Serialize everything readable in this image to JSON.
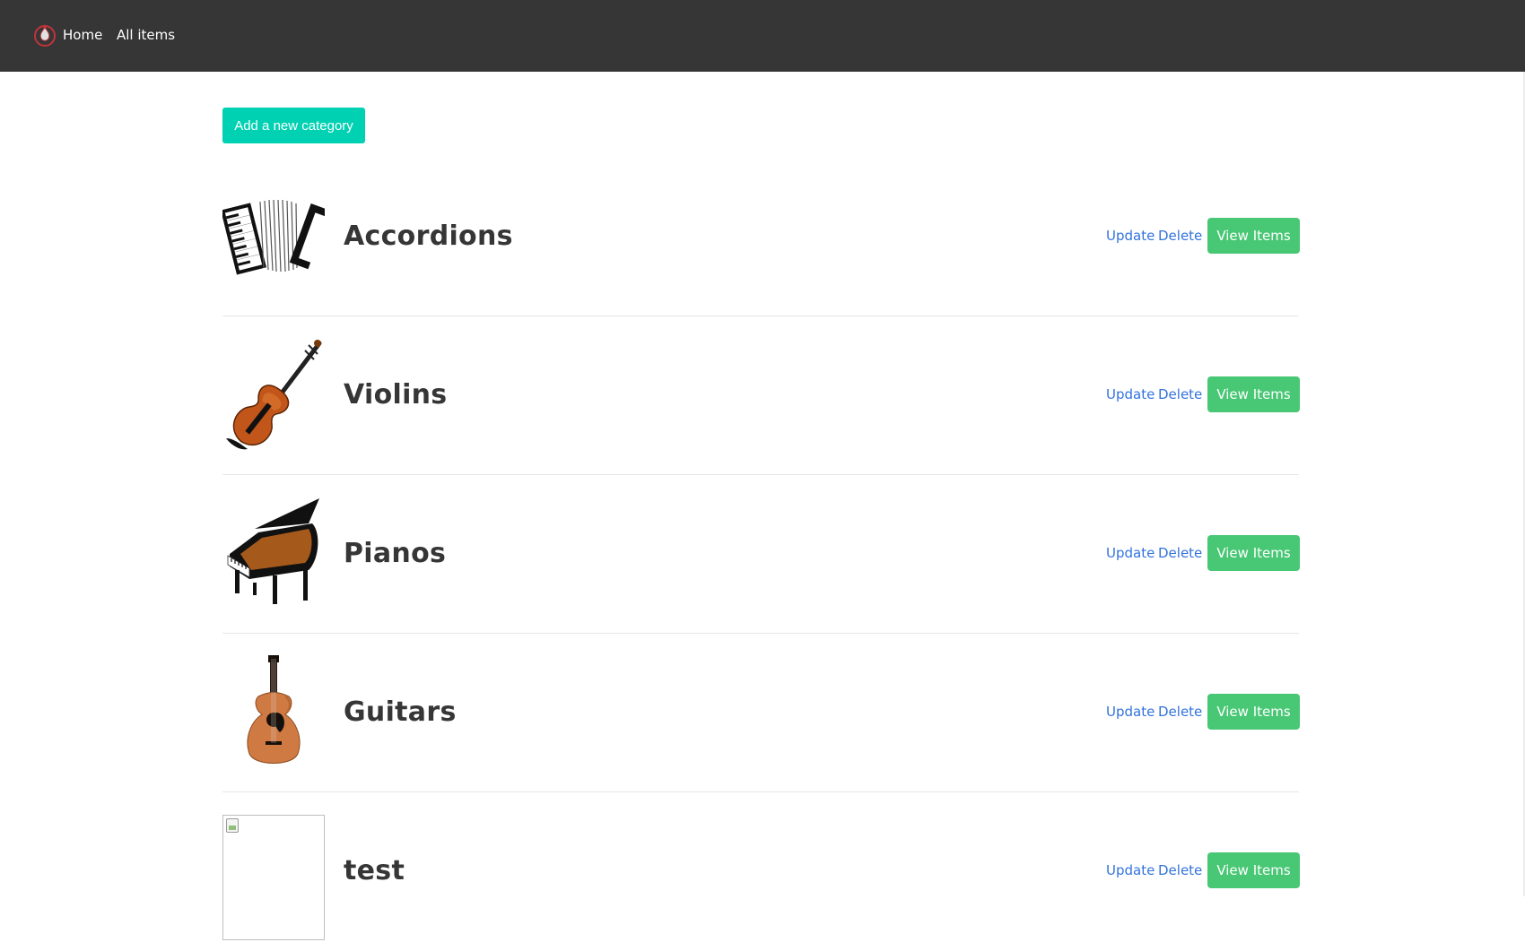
{
  "nav": {
    "home_label": "Home",
    "all_items_label": "All items"
  },
  "actions": {
    "add_category_label": "Add a new category"
  },
  "categories": [
    {
      "name": "Accordions",
      "icon": "accordion-image",
      "update_label": "Update",
      "delete_label": "Delete",
      "view_label": "View Items"
    },
    {
      "name": "Violins",
      "icon": "violin-image",
      "update_label": "Update",
      "delete_label": "Delete",
      "view_label": "View Items"
    },
    {
      "name": "Pianos",
      "icon": "piano-image",
      "update_label": "Update",
      "delete_label": "Delete",
      "view_label": "View Items"
    },
    {
      "name": "Guitars",
      "icon": "guitar-image",
      "update_label": "Update",
      "delete_label": "Delete",
      "view_label": "View Items"
    },
    {
      "name": "test",
      "icon": "broken-image",
      "update_label": "Update",
      "delete_label": "Delete",
      "view_label": "View Items"
    }
  ],
  "colors": {
    "navbar": "#363636",
    "primary": "#00d1b2",
    "success": "#48c774",
    "link": "#3273dc",
    "text": "#363636"
  }
}
